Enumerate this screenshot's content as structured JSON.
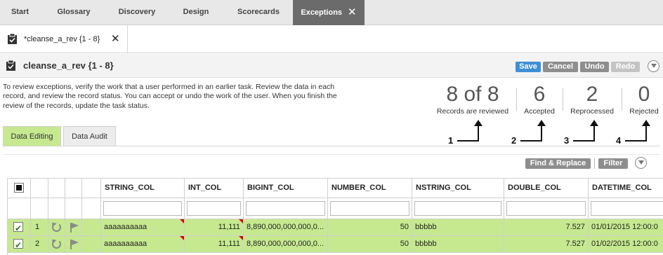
{
  "top_nav": {
    "tabs": [
      {
        "label": "Start"
      },
      {
        "label": "Glossary"
      },
      {
        "label": "Discovery"
      },
      {
        "label": "Design"
      },
      {
        "label": "Scorecards"
      },
      {
        "label": "Exceptions",
        "active": true
      }
    ]
  },
  "doc_tab": {
    "label": "*cleanse_a_rev {1 - 8}"
  },
  "task": {
    "title": "cleanse_a_rev {1 - 8}",
    "buttons": {
      "save": "Save",
      "cancel": "Cancel",
      "undo": "Undo",
      "redo": "Redo"
    }
  },
  "instructions": "To review exceptions, verify the work that a user performed in an earlier task. Review the data in each record, and review the record status. You can accept or undo the work of the user. When you finish the review of the records, update the task status.",
  "stats": [
    {
      "value": "8 of 8",
      "caption": "Records are reviewed",
      "callout": "1"
    },
    {
      "value": "6",
      "caption": "Accepted",
      "callout": "2"
    },
    {
      "value": "2",
      "caption": "Reprocessed",
      "callout": "3"
    },
    {
      "value": "0",
      "caption": "Rejected",
      "callout": "4"
    }
  ],
  "sub_tabs": [
    {
      "label": "Data Editing",
      "active": true
    },
    {
      "label": "Data Audit"
    }
  ],
  "grid_toolbar": {
    "find_replace": "Find & Replace",
    "filter": "Filter"
  },
  "grid": {
    "columns": [
      "STRING_COL",
      "INT_COL",
      "BIGINT_COL",
      "NUMBER_COL",
      "NSTRING_COL",
      "DOUBLE_COL",
      "DATETIME_COL"
    ],
    "rows": [
      {
        "num": "1",
        "string": "aaaaaaaaaa",
        "int": "11,111",
        "bigint": "8,890,000,000,000,0...",
        "number": "50",
        "nstring": "bbbbb",
        "double": "7.527",
        "datetime": "01/01/2015 12:00:0"
      },
      {
        "num": "2",
        "string": "aaaaaaaaaa",
        "int": "11,111",
        "bigint": "8,890,000,000,000,0...",
        "number": "50",
        "nstring": "bbbbb",
        "double": "7.527",
        "datetime": "01/02/2015 12:00:0"
      }
    ]
  },
  "colors": {
    "accent_green": "#c6e98f",
    "save_blue": "#3d8fd6",
    "active_tab": "#6b6b6b"
  }
}
